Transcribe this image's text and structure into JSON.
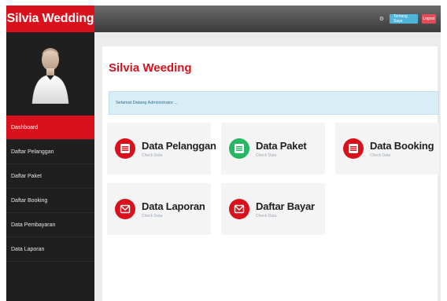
{
  "app": {
    "brand": "Silvia Wedding"
  },
  "topbar": {
    "gear_icon": "gear-icon",
    "info_label": "Tentang Saya",
    "logout_label": "Logout"
  },
  "sidebar": {
    "items": [
      {
        "label": "Dashboard",
        "active": true
      },
      {
        "label": "Daftar Pelanggan"
      },
      {
        "label": "Daftar Paket"
      },
      {
        "label": "Daftar Booking"
      },
      {
        "label": "Data Pembayaran"
      },
      {
        "label": "Data Laporan"
      }
    ]
  },
  "main": {
    "title": "Silvia Weeding",
    "alert": "Selamat Datang Administrator ...",
    "tiles": [
      {
        "title": "Data Pelanggan",
        "sub": "Check Data",
        "icon": "list-icon",
        "color": "#d9111d"
      },
      {
        "title": "Data Paket",
        "sub": "Check Data",
        "icon": "list-icon",
        "color": "#25b763"
      },
      {
        "title": "Data Booking",
        "sub": "Check Data",
        "icon": "list-icon",
        "color": "#d9111d"
      },
      {
        "title": "Data Laporan",
        "sub": "Check Data",
        "icon": "envelope-icon",
        "color": "#d9111d"
      },
      {
        "title": "Daftar Bayar",
        "sub": "Check Data",
        "icon": "envelope-icon",
        "color": "#d9111d"
      }
    ]
  },
  "colors": {
    "brand": "#d9111d",
    "accent_green": "#25b763",
    "info": "#4cb5d9",
    "danger": "#e24a57"
  }
}
